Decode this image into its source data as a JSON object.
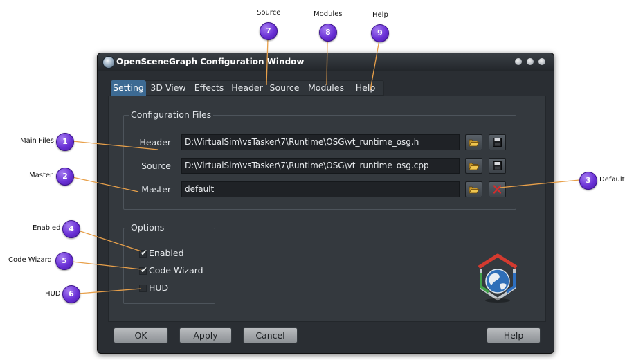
{
  "window": {
    "title": "OpenSceneGraph Configuration Window"
  },
  "tabs": [
    {
      "label": "Setting"
    },
    {
      "label": "3D View"
    },
    {
      "label": "Effects"
    },
    {
      "label": "Header"
    },
    {
      "label": "Source"
    },
    {
      "label": "Modules"
    },
    {
      "label": "Help"
    }
  ],
  "config_files": {
    "title": "Configuration Files",
    "rows": [
      {
        "label": "Header",
        "value": "D:\\VirtualSim\\vsTasker\\7\\Runtime\\OSG\\vt_runtime_osg.h"
      },
      {
        "label": "Source",
        "value": "D:\\VirtualSim\\vsTasker\\7\\Runtime\\OSG\\vt_runtime_osg.cpp"
      },
      {
        "label": "Master",
        "value": "default"
      }
    ]
  },
  "options": {
    "title": "Options",
    "items": [
      {
        "label": "Enabled",
        "checked": true
      },
      {
        "label": "Code Wizard",
        "checked": true
      },
      {
        "label": "HUD",
        "checked": false
      }
    ]
  },
  "buttons": {
    "ok": "OK",
    "apply": "Apply",
    "cancel": "Cancel",
    "help": "Help"
  },
  "annotations": {
    "main_files": {
      "num": "1",
      "label": "Main Files"
    },
    "master": {
      "num": "2",
      "label": "Master"
    },
    "default": {
      "num": "3",
      "label": "Default"
    },
    "enabled": {
      "num": "4",
      "label": "Enabled"
    },
    "code_wizard": {
      "num": "5",
      "label": "Code Wizard"
    },
    "hud": {
      "num": "6",
      "label": "HUD"
    },
    "source": {
      "num": "7",
      "label": "Source"
    },
    "modules": {
      "num": "8",
      "label": "Modules"
    },
    "help": {
      "num": "9",
      "label": "Help"
    }
  },
  "colors": {
    "badge": "#6a31d6",
    "pointer_line": "#e8a04a",
    "active_tab": "#3c6a93"
  }
}
